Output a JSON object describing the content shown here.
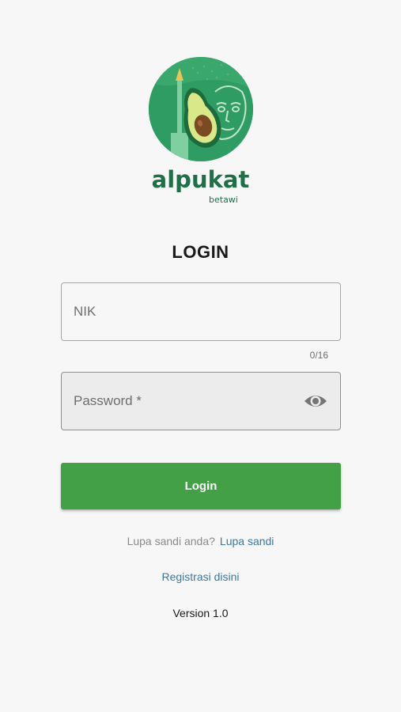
{
  "logo": {
    "icon": "avocado-logo-icon",
    "brand_name": "alpukat",
    "brand_sub": "betawi",
    "colors": {
      "circle": "#2f9c63",
      "brand_text": "#1f6f47"
    }
  },
  "title": "LOGIN",
  "nik": {
    "placeholder": "NIK",
    "value": "",
    "counter": "0/16"
  },
  "password": {
    "placeholder": "Password *",
    "value": "",
    "toggle_icon": "eye-icon"
  },
  "login_button": {
    "label": "Login",
    "color": "#43a047"
  },
  "forgot": {
    "question": "Lupa sandi anda?",
    "link": "Lupa sandi"
  },
  "register": {
    "link": "Registrasi disini"
  },
  "version": "Version 1.0",
  "colors": {
    "background": "#f7f7f7",
    "link": "#3a78a8"
  }
}
